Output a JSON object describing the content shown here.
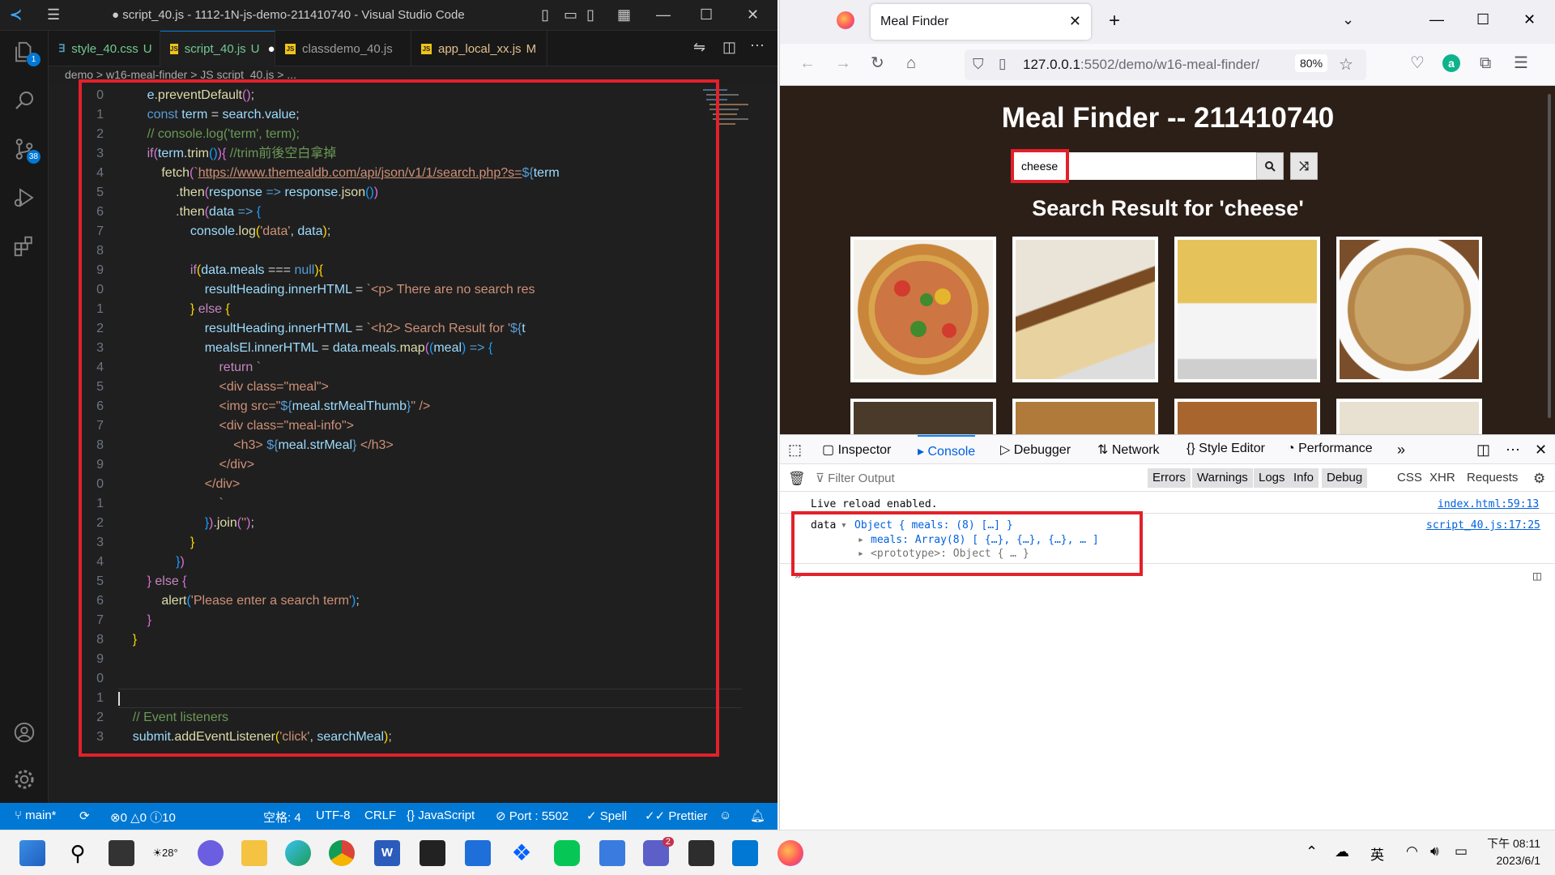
{
  "vscode": {
    "title": "● script_40.js - 1112-1N-js-demo-211410740 - Visual Studio Code",
    "tabs": [
      {
        "label": "style_40.css",
        "status": "U"
      },
      {
        "label": "script_40.js",
        "status": "U",
        "dirty": "●"
      },
      {
        "label": "classdemo_40.js",
        "status": ""
      },
      {
        "label": "app_local_xx.js",
        "status": "M"
      }
    ],
    "breadcrumb": "demo > w16-meal-finder > JS script_40.js > ...",
    "explorer_badge": "1",
    "scm_badge": "38",
    "line_numbers": [
      "0",
      "1",
      "2",
      "3",
      "4",
      "5",
      "6",
      "7",
      "8",
      "9",
      "0",
      "1",
      "2",
      "3",
      "4",
      "5",
      "6",
      "7",
      "8",
      "9",
      "0",
      "1",
      "2",
      "3",
      "4",
      "5",
      "6",
      "7",
      "8",
      "9",
      "0",
      "1",
      "2",
      "3"
    ],
    "statusbar": {
      "branch": "main*",
      "problems": "⊗0 △0 ⓘ10",
      "spaces": "空格: 4",
      "encoding": "UTF-8",
      "eol": "CRLF",
      "language": "JavaScript",
      "port": "Port : 5502",
      "spell": "Spell",
      "prettier": "Prettier"
    }
  },
  "firefox": {
    "tab_title": "Meal Finder",
    "url_host": "127.0.0.1",
    "url_rest": ":5502/demo/w16-meal-finder/",
    "zoom": "80%",
    "page": {
      "title": "Meal Finder -- 211410740",
      "search_value": "cheese",
      "result_heading": "Search Result for 'cheese'"
    },
    "devtools": {
      "tabs": [
        "Inspector",
        "Console",
        "Debugger",
        "Network",
        "Style Editor",
        "Performance"
      ],
      "filter_placeholder": "Filter Output",
      "filters": [
        "Errors",
        "Warnings",
        "Logs",
        "Info",
        "Debug",
        "CSS",
        "XHR",
        "Requests"
      ],
      "messages": [
        {
          "text": "Live reload enabled.",
          "source": "index.html:59:13"
        },
        {
          "label": "data",
          "summary": "Object { meals: (8) […] }",
          "source": "script_40.js:17:25"
        }
      ],
      "meals_line": "meals: Array(8) [ {…}, {…}, {…}, … ]",
      "proto_line": "<prototype>: Object { … }",
      "prompt": "»"
    }
  },
  "taskbar": {
    "weather": "28°",
    "teams_badge": "2",
    "ime": "英",
    "time": "下午 08:11",
    "date": "2023/6/1"
  }
}
